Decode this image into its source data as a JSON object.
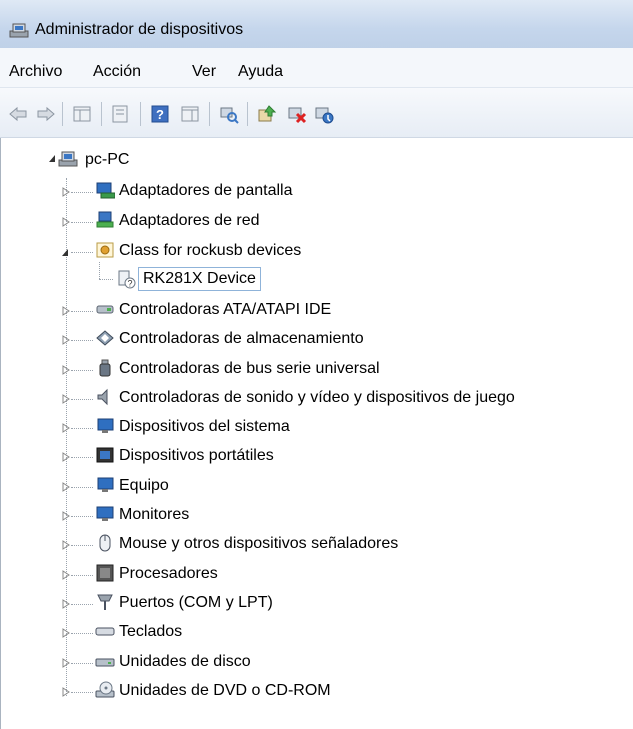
{
  "window": {
    "title": "Administrador de dispositivos"
  },
  "menu": {
    "items": [
      "Archivo",
      "Acción",
      "Ver",
      "Ayuda"
    ]
  },
  "toolbar": {
    "buttons": [
      {
        "name": "back-arrow-icon"
      },
      {
        "name": "forward-arrow-icon"
      },
      {
        "name": "show-hide-console-tree-icon"
      },
      {
        "name": "properties-icon"
      },
      {
        "name": "help-icon"
      },
      {
        "name": "action-pane-icon"
      },
      {
        "name": "scan-hardware-changes-icon"
      },
      {
        "name": "update-driver-icon"
      },
      {
        "name": "uninstall-device-icon"
      },
      {
        "name": "disable-device-icon"
      }
    ]
  },
  "tree": {
    "root": "pc-PC",
    "items": [
      {
        "label": "Adaptadores de pantalla",
        "icon": "display-adapter-icon",
        "expanded": false
      },
      {
        "label": "Adaptadores de red",
        "icon": "network-adapter-icon",
        "expanded": false
      },
      {
        "label": "Class for rockusb devices",
        "icon": "rockusb-class-icon",
        "expanded": true,
        "children": [
          {
            "label": "RK281X Device",
            "icon": "unknown-device-icon",
            "selected": true
          }
        ]
      },
      {
        "label": "Controladoras ATA/ATAPI IDE",
        "icon": "ide-controller-icon",
        "expanded": false
      },
      {
        "label": "Controladoras de almacenamiento",
        "icon": "storage-controller-icon",
        "expanded": false
      },
      {
        "label": "Controladoras de bus serie universal",
        "icon": "usb-controller-icon",
        "expanded": false
      },
      {
        "label": "Controladoras de sonido y vídeo y dispositivos de juego",
        "icon": "sound-icon",
        "expanded": false
      },
      {
        "label": "Dispositivos del sistema",
        "icon": "system-devices-icon",
        "expanded": false
      },
      {
        "label": "Dispositivos portátiles",
        "icon": "portable-devices-icon",
        "expanded": false
      },
      {
        "label": "Equipo",
        "icon": "computer-icon",
        "expanded": false
      },
      {
        "label": "Monitores",
        "icon": "monitor-icon",
        "expanded": false
      },
      {
        "label": "Mouse y otros dispositivos señaladores",
        "icon": "mouse-icon",
        "expanded": false
      },
      {
        "label": "Procesadores",
        "icon": "processor-icon",
        "expanded": false
      },
      {
        "label": "Puertos (COM y LPT)",
        "icon": "ports-icon",
        "expanded": false
      },
      {
        "label": "Teclados",
        "icon": "keyboard-icon",
        "expanded": false
      },
      {
        "label": "Unidades de disco",
        "icon": "disk-drive-icon",
        "expanded": false
      },
      {
        "label": "Unidades de DVD o CD-ROM",
        "icon": "dvd-drive-icon",
        "expanded": false
      }
    ]
  }
}
